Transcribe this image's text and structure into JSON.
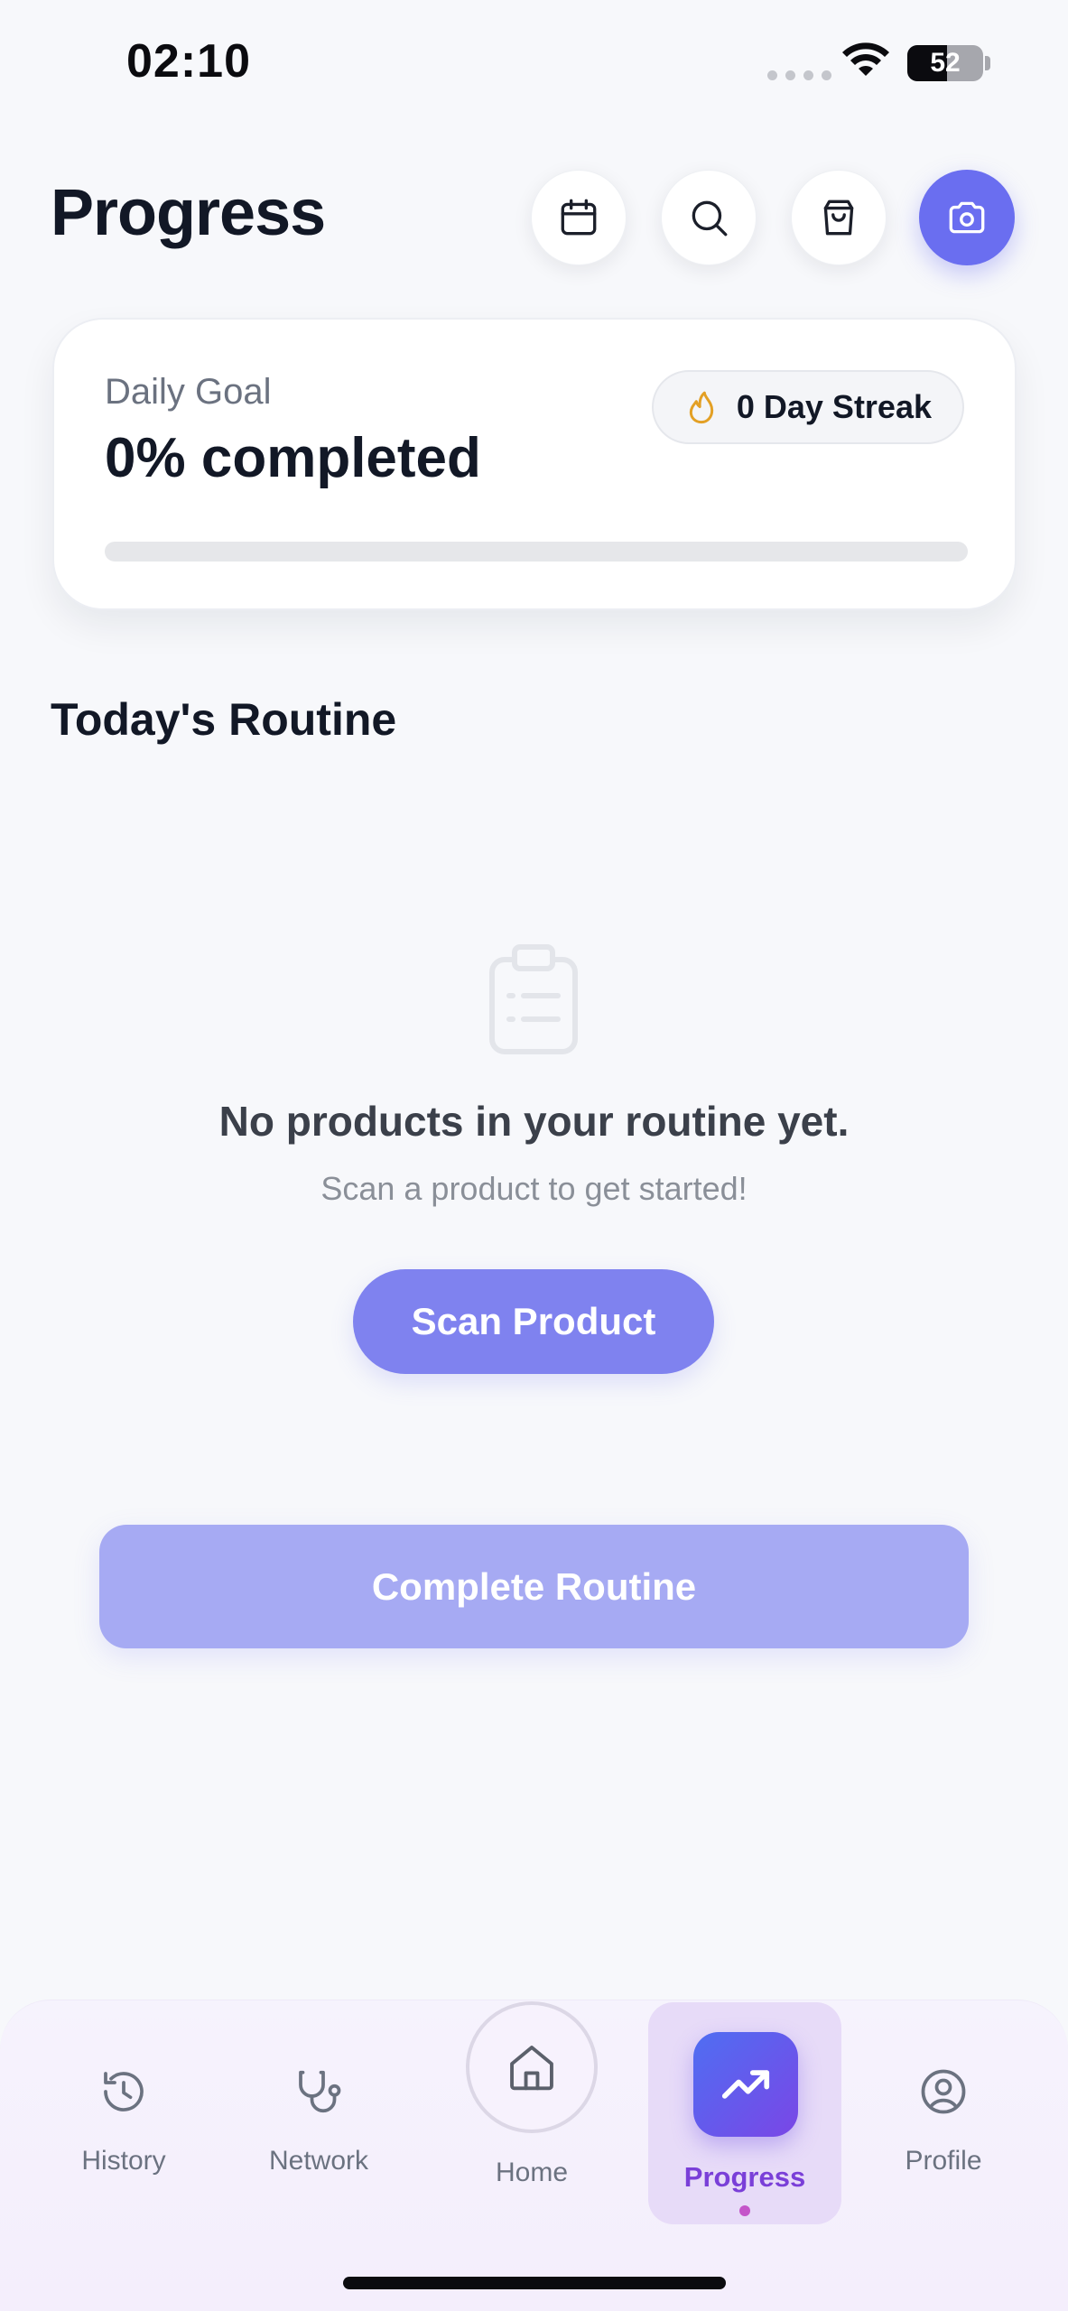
{
  "status_bar": {
    "time": "02:10",
    "battery_level": "52",
    "battery_percent": 52
  },
  "header": {
    "title": "Progress",
    "icons": [
      "calendar-icon",
      "search-icon",
      "shopping-bag-icon",
      "camera-icon"
    ],
    "accent_color": "#6a6ef0"
  },
  "goal_card": {
    "label": "Daily Goal",
    "value_text": "0% completed",
    "progress_percent": 0,
    "streak_text": "0 Day Streak",
    "streak_icon": "flame-icon"
  },
  "routine": {
    "title": "Today's Routine",
    "empty_icon": "clipboard-icon",
    "empty_title": "No products in your routine yet.",
    "empty_subtitle": "Scan a product to get started!",
    "scan_button": "Scan Product",
    "complete_button": "Complete Routine"
  },
  "bottom_nav": {
    "items": [
      {
        "label": "History",
        "icon": "history-icon"
      },
      {
        "label": "Network",
        "icon": "stethoscope-icon"
      },
      {
        "label": "Home",
        "icon": "home-icon"
      },
      {
        "label": "Progress",
        "icon": "trending-up-icon",
        "active": true
      },
      {
        "label": "Profile",
        "icon": "user-circle-icon"
      }
    ],
    "active_color": "#7a3fd8"
  }
}
